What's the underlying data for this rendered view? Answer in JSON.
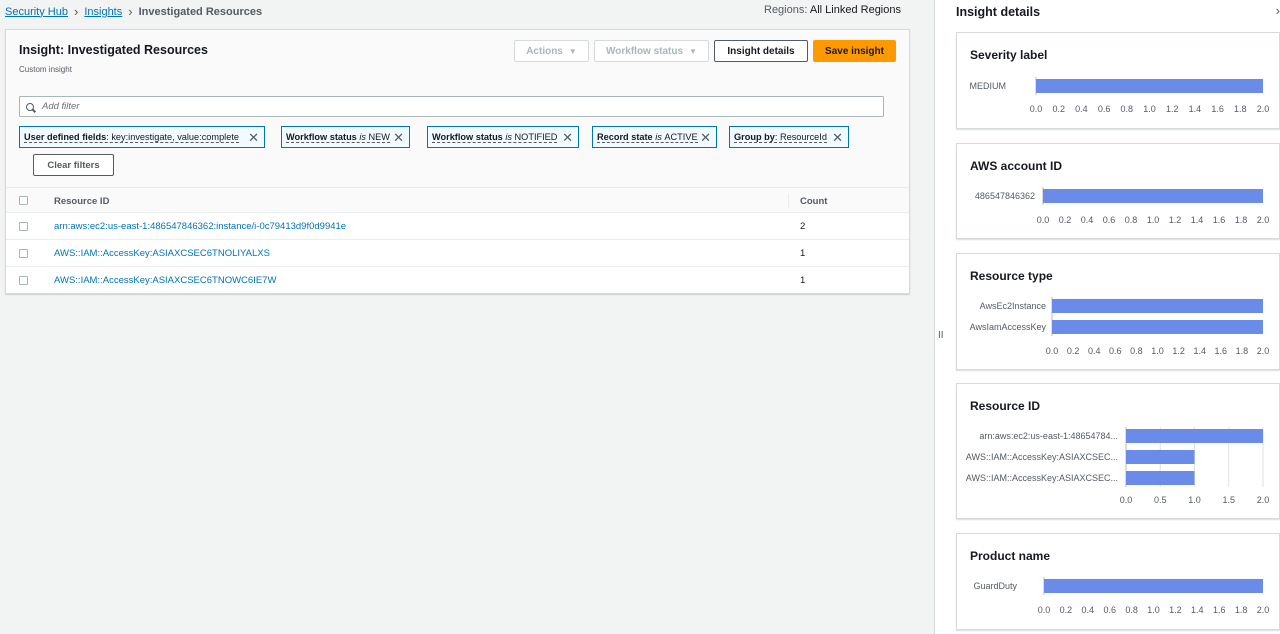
{
  "breadcrumb": {
    "items": [
      "Security Hub",
      "Insights"
    ],
    "current": "Investigated Resources"
  },
  "regions": {
    "label": "Regions:",
    "value": "All Linked Regions"
  },
  "insight": {
    "title": "Insight: Investigated Resources",
    "subtitle": "Custom insight",
    "actions_label": "Actions",
    "workflow_label": "Workflow status",
    "details_label": "Insight details",
    "save_label": "Save insight"
  },
  "filter": {
    "placeholder": "Add filter"
  },
  "tokens": [
    {
      "key": "User defined fields",
      "op": ": ",
      "value": "key:investigate, value:complete"
    },
    {
      "key": "Workflow status",
      "op": " is ",
      "value": "NEW"
    },
    {
      "key": "Workflow status",
      "op": " is ",
      "value": "NOTIFIED"
    },
    {
      "key": "Record state",
      "op": " is ",
      "value": "ACTIVE"
    },
    {
      "key": "Group by",
      "op": ": ",
      "value": "ResourceId"
    }
  ],
  "clear_filters_label": "Clear filters",
  "table": {
    "headers": [
      "Resource ID",
      "Count"
    ],
    "rows": [
      {
        "id": "arn:aws:ec2:us-east-1:486547846362:instance/i-0c79413d9f0d9941e",
        "count": "2"
      },
      {
        "id": "AWS::IAM::AccessKey:ASIAXCSEC6TNOLIYALXS",
        "count": "1"
      },
      {
        "id": "AWS::IAM::AccessKey:ASIAXCSEC6TNOWC6IE7W",
        "count": "1"
      }
    ]
  },
  "panel": {
    "title": "Insight details"
  },
  "colors": {
    "bar": "#6b8be8",
    "link": "#0073bb",
    "accent": "#ff9900"
  },
  "chart_data": [
    {
      "type": "bar",
      "title": "Severity label",
      "categories": [
        "MEDIUM"
      ],
      "values": [
        2
      ],
      "xlim": [
        0,
        2
      ],
      "ticks": [
        "0.0",
        "0.2",
        "0.4",
        "0.6",
        "0.8",
        "1.0",
        "1.2",
        "1.4",
        "1.6",
        "1.8",
        "2.0"
      ]
    },
    {
      "type": "bar",
      "title": "AWS account ID",
      "categories": [
        "486547846362"
      ],
      "values": [
        2
      ],
      "xlim": [
        0,
        2
      ],
      "ticks": [
        "0.0",
        "0.2",
        "0.4",
        "0.6",
        "0.8",
        "1.0",
        "1.2",
        "1.4",
        "1.6",
        "1.8",
        "2.0"
      ]
    },
    {
      "type": "bar",
      "title": "Resource type",
      "categories": [
        "AwsEc2Instance",
        "AwsIamAccessKey"
      ],
      "values": [
        2,
        2
      ],
      "xlim": [
        0,
        2
      ],
      "ticks": [
        "0.0",
        "0.2",
        "0.4",
        "0.6",
        "0.8",
        "1.0",
        "1.2",
        "1.4",
        "1.6",
        "1.8",
        "2.0"
      ]
    },
    {
      "type": "bar",
      "title": "Resource ID",
      "categories": [
        "arn:aws:ec2:us-east-1:48654784...",
        "AWS::IAM::AccessKey:ASIAXCSEC...",
        "AWS::IAM::AccessKey:ASIAXCSEC..."
      ],
      "values": [
        2,
        1,
        1
      ],
      "xlim": [
        0,
        2
      ],
      "ticks": [
        "0.0",
        "0.5",
        "1.0",
        "1.5",
        "2.0"
      ],
      "grid": true
    },
    {
      "type": "bar",
      "title": "Product name",
      "categories": [
        "GuardDuty"
      ],
      "values": [
        2
      ],
      "xlim": [
        0,
        2
      ],
      "ticks": [
        "0.0",
        "0.2",
        "0.4",
        "0.6",
        "0.8",
        "1.0",
        "1.2",
        "1.4",
        "1.6",
        "1.8",
        "2.0"
      ]
    }
  ]
}
